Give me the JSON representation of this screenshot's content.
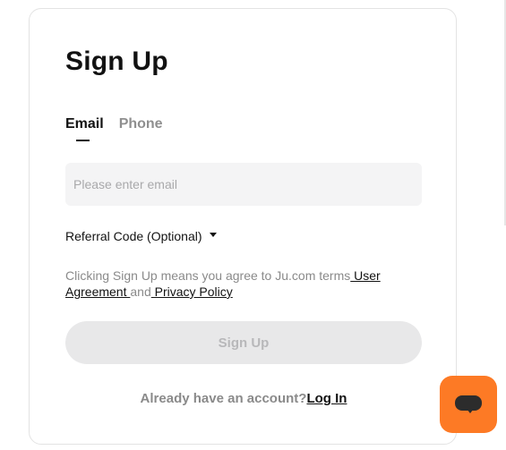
{
  "title": "Sign Up",
  "tabs": [
    {
      "label": "Email",
      "active": true
    },
    {
      "label": "Phone",
      "active": false
    }
  ],
  "email_input": {
    "placeholder": "Please enter email",
    "value": ""
  },
  "referral": {
    "label": "Referral Code (Optional)"
  },
  "terms": {
    "prefix": "Clicking Sign Up means you agree to Ju.com terms",
    "user_agreement": " User Agreement ",
    "conjunction": "and",
    "privacy_policy": " Privacy Policy"
  },
  "signup_button": {
    "label": "Sign Up",
    "disabled": true
  },
  "login": {
    "prompt": "Already have an account?",
    "link": "Log In"
  },
  "colors": {
    "accent": "#fd7a25",
    "primary_text": "#121212",
    "muted_text": "#8a8a8a",
    "input_bg": "#f4f4f5",
    "button_disabled_bg": "#e8e8e9"
  },
  "icons": {
    "referral": "caret-down-icon",
    "chat": "chat-icon"
  }
}
